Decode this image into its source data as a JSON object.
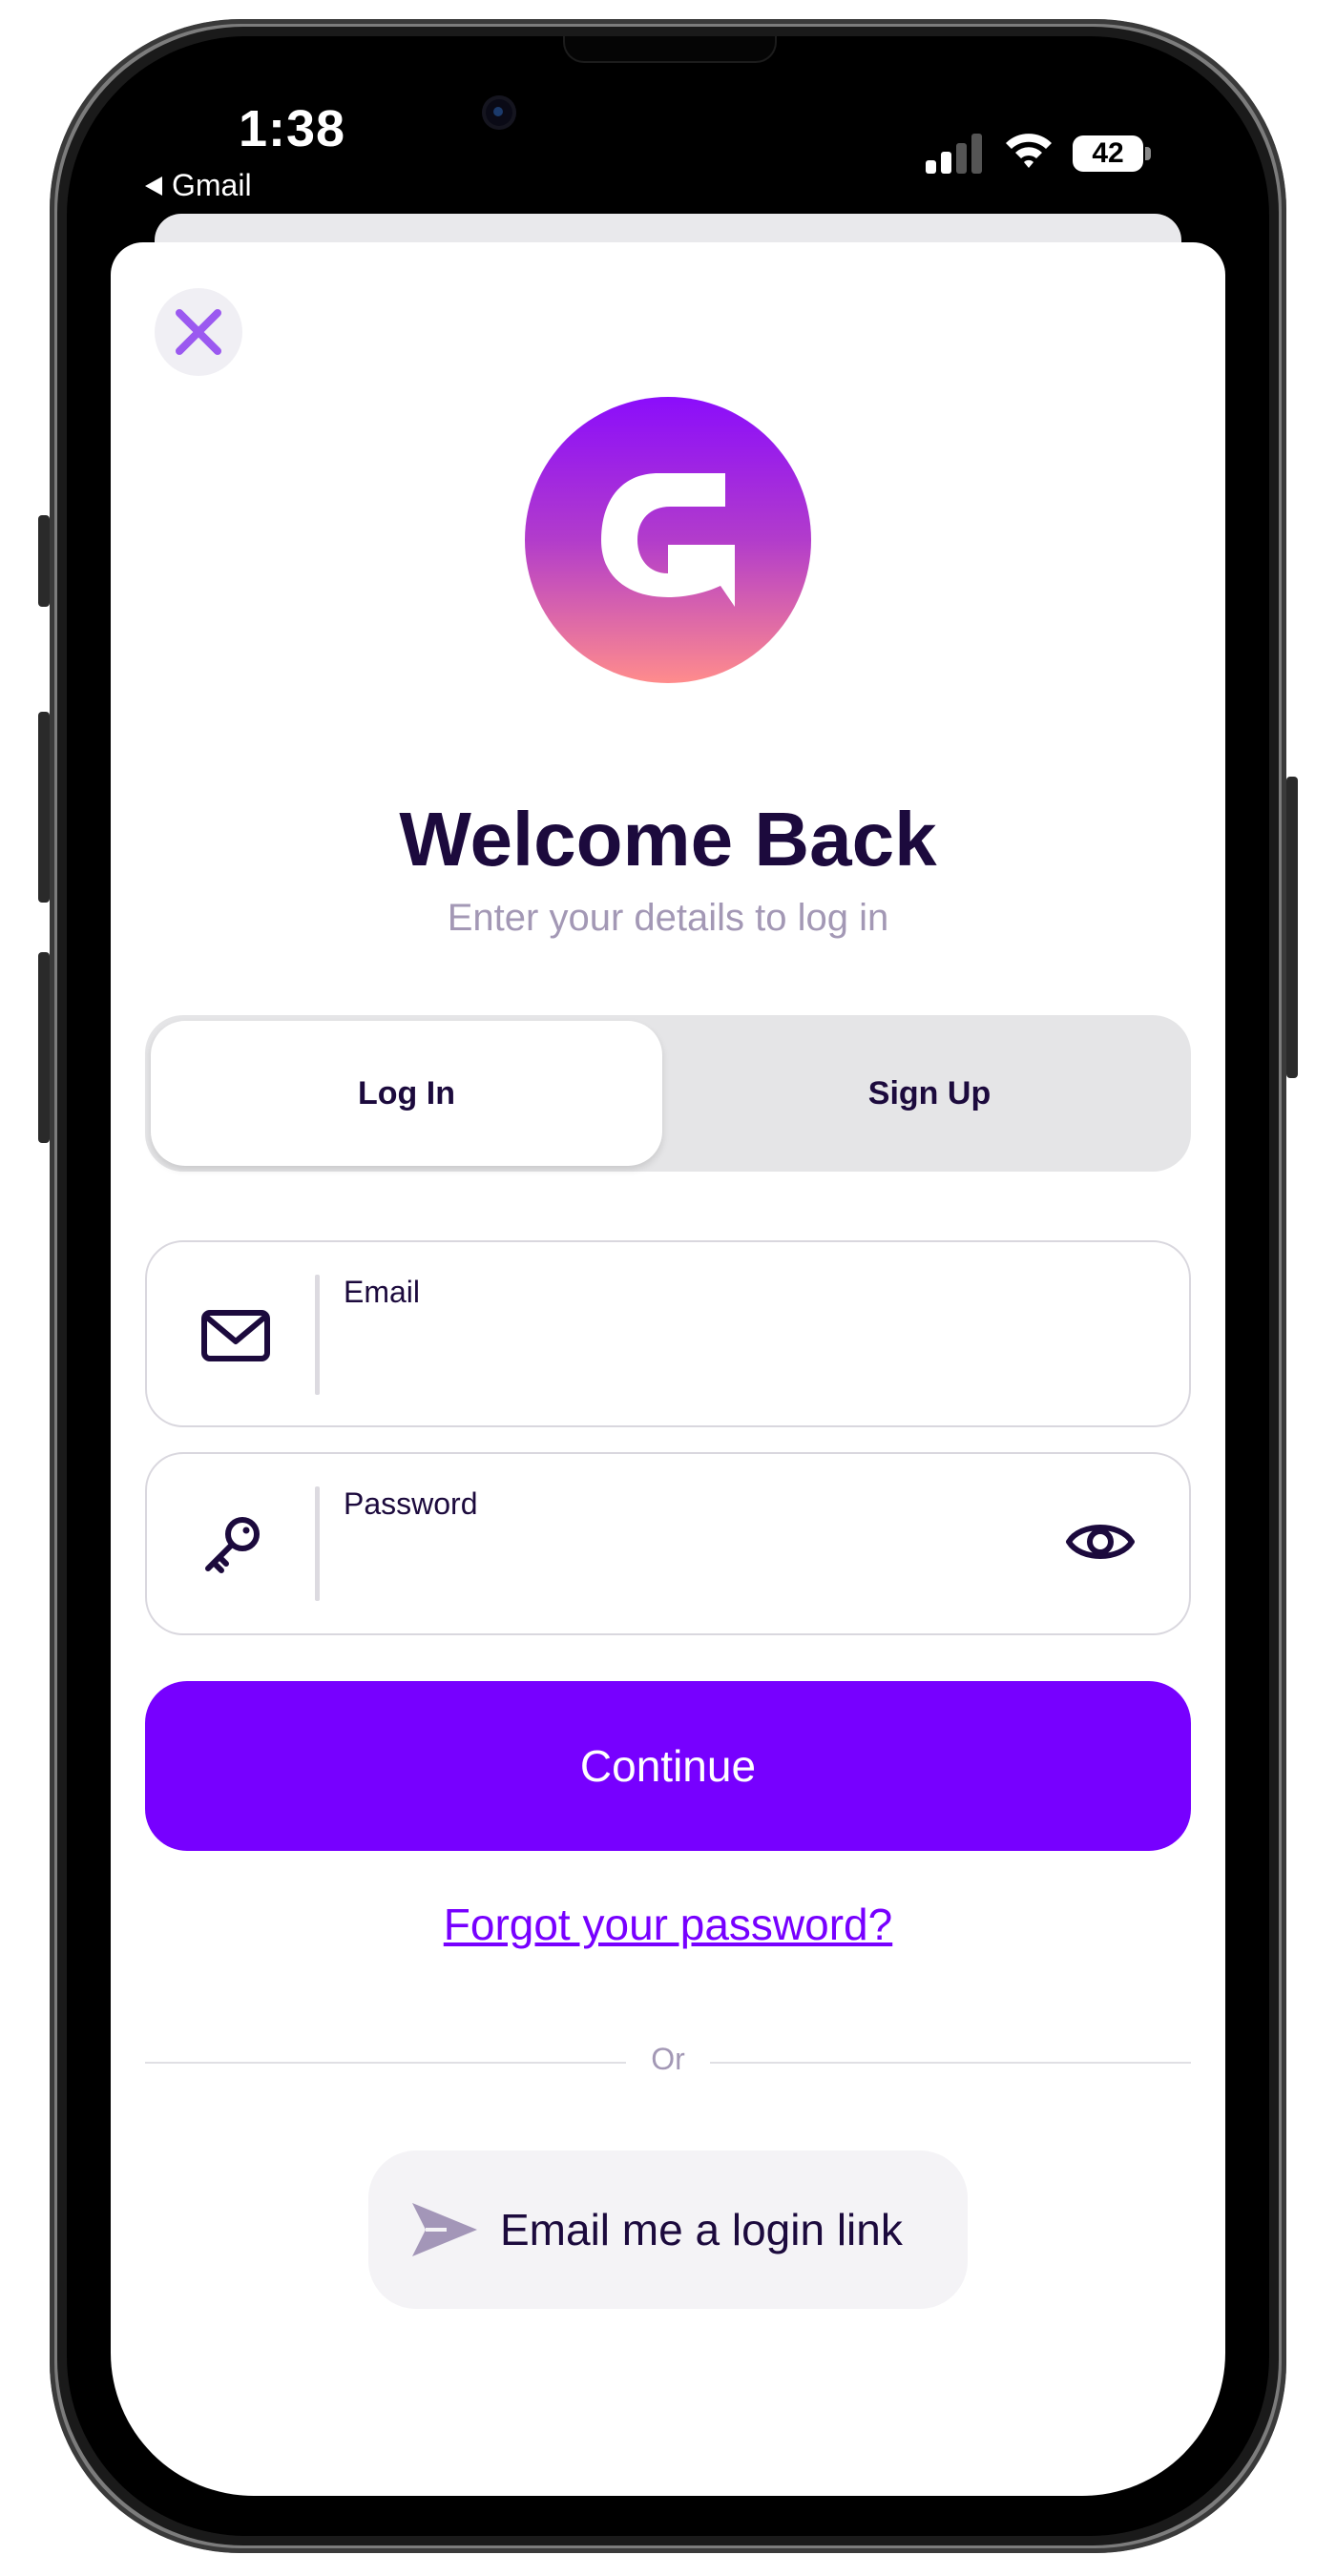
{
  "status_bar": {
    "time": "1:38",
    "back_app": "Gmail",
    "battery": "42"
  },
  "header": {
    "close_icon": "close-icon",
    "logo_letter": "G",
    "title": "Welcome Back",
    "subtitle": "Enter your details to log in"
  },
  "tabs": {
    "login": "Log In",
    "signup": "Sign Up",
    "selected": "Log In"
  },
  "form": {
    "email_label": "Email",
    "email_value": "",
    "password_label": "Password",
    "password_value": "",
    "continue_label": "Continue",
    "forgot_label": "Forgot your password?"
  },
  "alt": {
    "or_label": "Or",
    "magic_link_label": "Email me a login link"
  },
  "colors": {
    "accent": "#7700ff",
    "title": "#1c0a3d",
    "muted": "#a398b5",
    "close_icon": "#9b59f0"
  },
  "icons": [
    "close-icon",
    "logo-icon",
    "mail-icon",
    "key-icon",
    "eye-icon",
    "send-icon",
    "signal-icon",
    "wifi-icon",
    "battery-icon"
  ]
}
